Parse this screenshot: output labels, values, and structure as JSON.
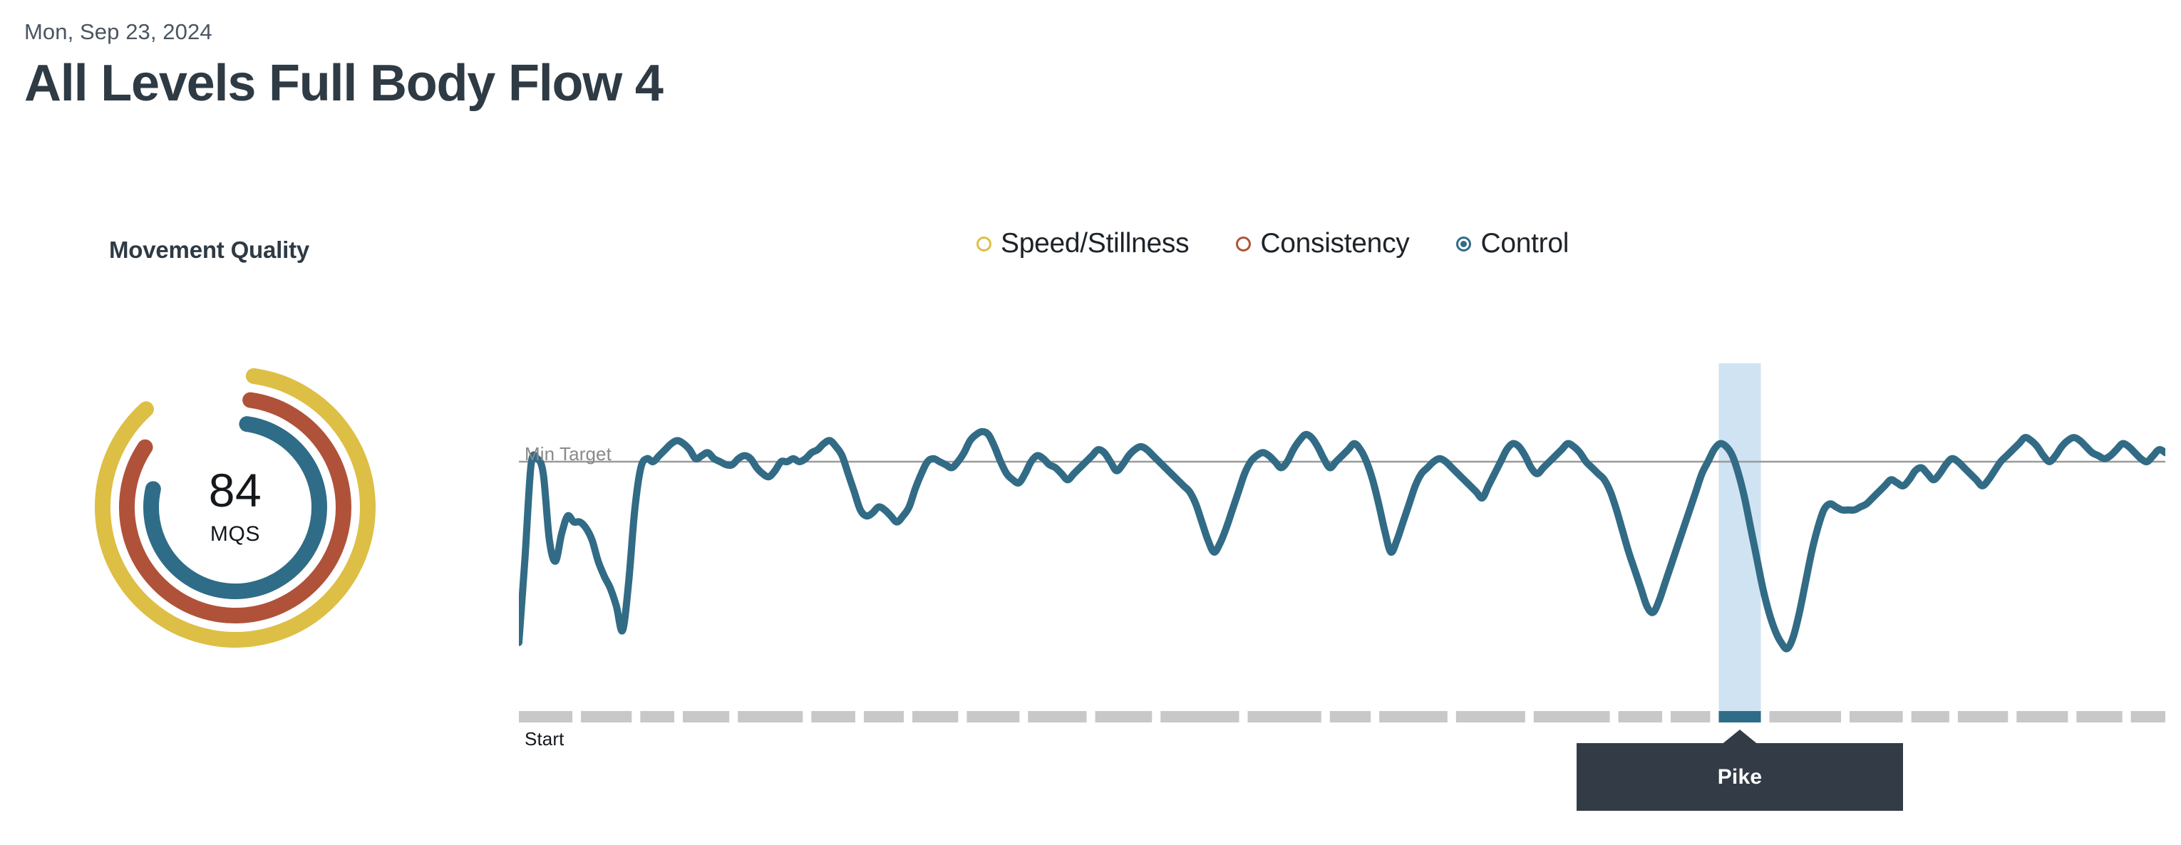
{
  "header": {
    "date": "Mon, Sep 23, 2024",
    "title": "All Levels Full Body Flow 4"
  },
  "movement_quality": {
    "heading": "Movement Quality",
    "score": "84",
    "unit": "MQS"
  },
  "legend": {
    "items": [
      {
        "label": "Speed/Stillness",
        "color": "#ddbf45",
        "selected": false,
        "name": "speed-stillness"
      },
      {
        "label": "Consistency",
        "color": "#b0523a",
        "selected": false,
        "name": "consistency"
      },
      {
        "label": "Control",
        "color": "#2f6c87",
        "selected": true,
        "name": "control"
      }
    ]
  },
  "chart": {
    "min_target_label": "Min Target",
    "start_label": "Start",
    "line_color": "#326b85",
    "min_target_color": "#9a9a9a",
    "highlight_color": "#cfe3f2",
    "segment_color": "#c8c8c8",
    "segment_active_color": "#2f6c87"
  },
  "tooltip": {
    "label": "Pike",
    "background": "#333c46",
    "text_color": "#ffffff"
  },
  "chart_data": {
    "type": "line",
    "title": "Movement Quality - Control over session",
    "xlabel": "",
    "ylabel": "Control",
    "ylim": [
      0,
      100
    ],
    "grid": false,
    "legend_position": "top-center",
    "annotations": [
      {
        "text": "Min Target",
        "type": "hline",
        "y": 78
      },
      {
        "text": "Start",
        "type": "axis-start"
      },
      {
        "text": "Pike",
        "type": "tooltip",
        "segment_index": 19
      }
    ],
    "series": [
      {
        "name": "Control",
        "color": "#326b85",
        "values": [
          18,
          46,
          77,
          79,
          74,
          52,
          45,
          54,
          60,
          58,
          58,
          56,
          52,
          45,
          40,
          36,
          30,
          22,
          38,
          62,
          76,
          79,
          78,
          80,
          82,
          84,
          85,
          84,
          82,
          79,
          80,
          81,
          79,
          78,
          77,
          77,
          79,
          80,
          79,
          76,
          74,
          73,
          75,
          78,
          78,
          79,
          78,
          79,
          81,
          82,
          84,
          85,
          83,
          80,
          74,
          68,
          62,
          60,
          61,
          63,
          62,
          60,
          58,
          60,
          63,
          69,
          74,
          78,
          79,
          78,
          77,
          76,
          78,
          81,
          85,
          87,
          88,
          87,
          83,
          78,
          74,
          72,
          71,
          74,
          78,
          80,
          79,
          77,
          76,
          74,
          72,
          74,
          76,
          78,
          80,
          82,
          81,
          78,
          75,
          77,
          80,
          82,
          83,
          82,
          80,
          78,
          76,
          74,
          72,
          70,
          68,
          64,
          58,
          52,
          48,
          51,
          56,
          62,
          68,
          74,
          78,
          80,
          81,
          80,
          78,
          76,
          78,
          82,
          85,
          87,
          86,
          83,
          79,
          76,
          78,
          80,
          82,
          84,
          82,
          78,
          72,
          64,
          55,
          48,
          52,
          58,
          64,
          70,
          74,
          76,
          78,
          79,
          78,
          76,
          74,
          72,
          70,
          68,
          66,
          70,
          74,
          78,
          82,
          84,
          83,
          80,
          76,
          74,
          76,
          78,
          80,
          82,
          84,
          83,
          81,
          78,
          76,
          74,
          72,
          68,
          62,
          55,
          48,
          42,
          36,
          30,
          28,
          32,
          38,
          44,
          50,
          56,
          62,
          68,
          74,
          78,
          82,
          84,
          83,
          80,
          74,
          66,
          56,
          46,
          36,
          28,
          22,
          18,
          16,
          20,
          28,
          38,
          48,
          56,
          62,
          64,
          63,
          62,
          62,
          62,
          63,
          64,
          66,
          68,
          70,
          72,
          71,
          70,
          72,
          75,
          76,
          74,
          72,
          74,
          77,
          79,
          78,
          76,
          74,
          72,
          70,
          72,
          75,
          78,
          80,
          82,
          84,
          86,
          85,
          83,
          80,
          78,
          80,
          83,
          85,
          86,
          85,
          83,
          81,
          80,
          79,
          80,
          82,
          84,
          83,
          81,
          79,
          78,
          80,
          82,
          81
        ]
      }
    ],
    "segments": [
      {
        "index": 0,
        "label": "",
        "active": false
      },
      {
        "index": 1,
        "label": "",
        "active": false
      },
      {
        "index": 2,
        "label": "",
        "active": false
      },
      {
        "index": 3,
        "label": "",
        "active": false
      },
      {
        "index": 4,
        "label": "",
        "active": false
      },
      {
        "index": 5,
        "label": "",
        "active": false
      },
      {
        "index": 6,
        "label": "",
        "active": false
      },
      {
        "index": 7,
        "label": "",
        "active": false
      },
      {
        "index": 8,
        "label": "",
        "active": false
      },
      {
        "index": 9,
        "label": "",
        "active": false
      },
      {
        "index": 10,
        "label": "",
        "active": false
      },
      {
        "index": 11,
        "label": "",
        "active": false
      },
      {
        "index": 12,
        "label": "",
        "active": false
      },
      {
        "index": 13,
        "label": "",
        "active": false
      },
      {
        "index": 14,
        "label": "",
        "active": false
      },
      {
        "index": 15,
        "label": "",
        "active": false
      },
      {
        "index": 16,
        "label": "",
        "active": false
      },
      {
        "index": 17,
        "label": "",
        "active": false
      },
      {
        "index": 18,
        "label": "",
        "active": false
      },
      {
        "index": 19,
        "label": "Pike",
        "active": true
      },
      {
        "index": 20,
        "label": "",
        "active": false
      },
      {
        "index": 21,
        "label": "",
        "active": false
      },
      {
        "index": 22,
        "label": "",
        "active": false
      },
      {
        "index": 23,
        "label": "",
        "active": false
      },
      {
        "index": 24,
        "label": "",
        "active": false
      },
      {
        "index": 25,
        "label": "",
        "active": false
      },
      {
        "index": 26,
        "label": "",
        "active": false
      }
    ]
  },
  "gauge_data": {
    "type": "radial",
    "center_value": "84",
    "center_unit": "MQS",
    "rings": [
      {
        "name": "Speed/Stillness",
        "color": "#ddbf45",
        "value": 88,
        "radius": 186,
        "stroke": 22
      },
      {
        "name": "Consistency",
        "color": "#b0523a",
        "value": 84,
        "radius": 152,
        "stroke": 22
      },
      {
        "name": "Control",
        "color": "#2f6c87",
        "value": 78,
        "radius": 118,
        "stroke": 22
      }
    ]
  }
}
